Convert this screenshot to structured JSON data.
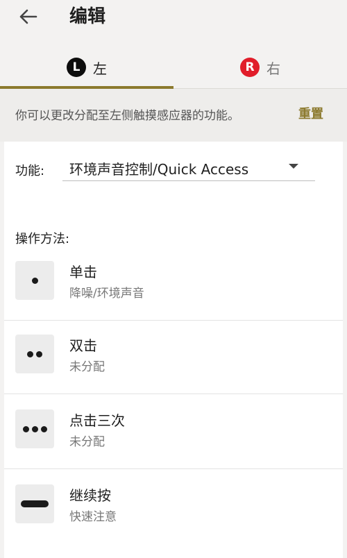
{
  "header": {
    "title": "编辑",
    "back_icon": "arrow-left-icon"
  },
  "tabs": [
    {
      "badge": "L",
      "label": "左",
      "active": true,
      "badge_color": "#0d0d0d"
    },
    {
      "badge": "R",
      "label": "右",
      "active": false,
      "badge_color": "#e11d2a"
    }
  ],
  "description": {
    "text": "你可以更改分配至左侧触摸感应器的功能。",
    "reset_label": "重置"
  },
  "function": {
    "label": "功能:",
    "value": "环境声音控制/Quick Access"
  },
  "operations": {
    "title": "操作方法:",
    "items": [
      {
        "name": "单击",
        "assignment": "降噪/环境声音",
        "icon": "single-tap-icon"
      },
      {
        "name": "双击",
        "assignment": "未分配",
        "icon": "double-tap-icon"
      },
      {
        "name": "点击三次",
        "assignment": "未分配",
        "icon": "triple-tap-icon"
      },
      {
        "name": "继续按",
        "assignment": "快速注意",
        "icon": "long-press-icon"
      }
    ]
  },
  "colors": {
    "accent": "#8c7a2e",
    "background": "#f3f2f1"
  }
}
